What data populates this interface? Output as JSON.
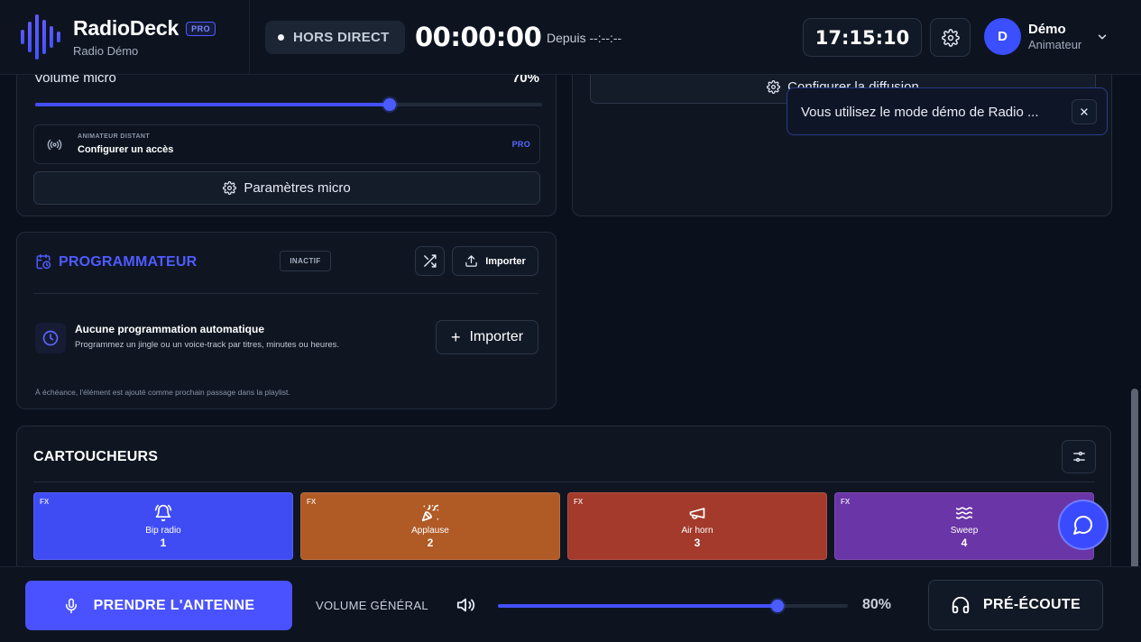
{
  "brand": {
    "name": "RadioDeck",
    "badge": "PRO",
    "subtitle": "Radio Démo"
  },
  "header": {
    "live_status": "HORS DIRECT",
    "timer": "00:00:00",
    "since": "Depuis --:--:--",
    "clock": "17:15:10",
    "user": {
      "initial": "D",
      "name": "Démo",
      "role": "Animateur"
    }
  },
  "mic": {
    "volume_label": "Volume micro",
    "volume_value": "70%",
    "volume_percent": 70,
    "remote": {
      "small_label": "ANIMATEUR DISTANT",
      "main_label": "Configurer un accès",
      "badge": "PRO"
    },
    "params_button": "Paramètres micro"
  },
  "diffusion": {
    "config_button": "Configurer la diffusion"
  },
  "toast": {
    "message": "Vous utilisez le mode démo de Radio ..."
  },
  "programmer": {
    "title": "PROGRAMMATEUR",
    "status": "INACTIF",
    "import_small": "Importer",
    "empty_title": "Aucune programmation automatique",
    "empty_subtitle": "Programmez un jingle ou un voice-track par titres, minutes ou heures.",
    "import_large": "Importer",
    "footer_note": "À échéance, l'élément est ajouté comme prochain passage dans la playlist."
  },
  "carts": {
    "title": "CARTOUCHEURS",
    "pads": [
      {
        "tag": "FX",
        "label": "Bip radio",
        "number": "1",
        "color": "#3f4cf4",
        "icon": "bell-icon"
      },
      {
        "tag": "FX",
        "label": "Applause",
        "number": "2",
        "color": "#b05a26",
        "icon": "party-popper-icon"
      },
      {
        "tag": "FX",
        "label": "Air horn",
        "number": "3",
        "color": "#a33a2b",
        "icon": "megaphone-icon"
      },
      {
        "tag": "FX",
        "label": "Sweep",
        "number": "4",
        "color": "#6a35a6",
        "icon": "waves-icon"
      }
    ]
  },
  "footer": {
    "on_air_button": "PRENDRE L'ANTENNE",
    "volume_label": "VOLUME GÉNÉRAL",
    "volume_value": "80%",
    "volume_percent": 80,
    "preview_button": "PRÉ-ÉCOUTE"
  },
  "colors": {
    "accent": "#4a52ff",
    "background": "#0b111c",
    "card": "#0f1622"
  }
}
